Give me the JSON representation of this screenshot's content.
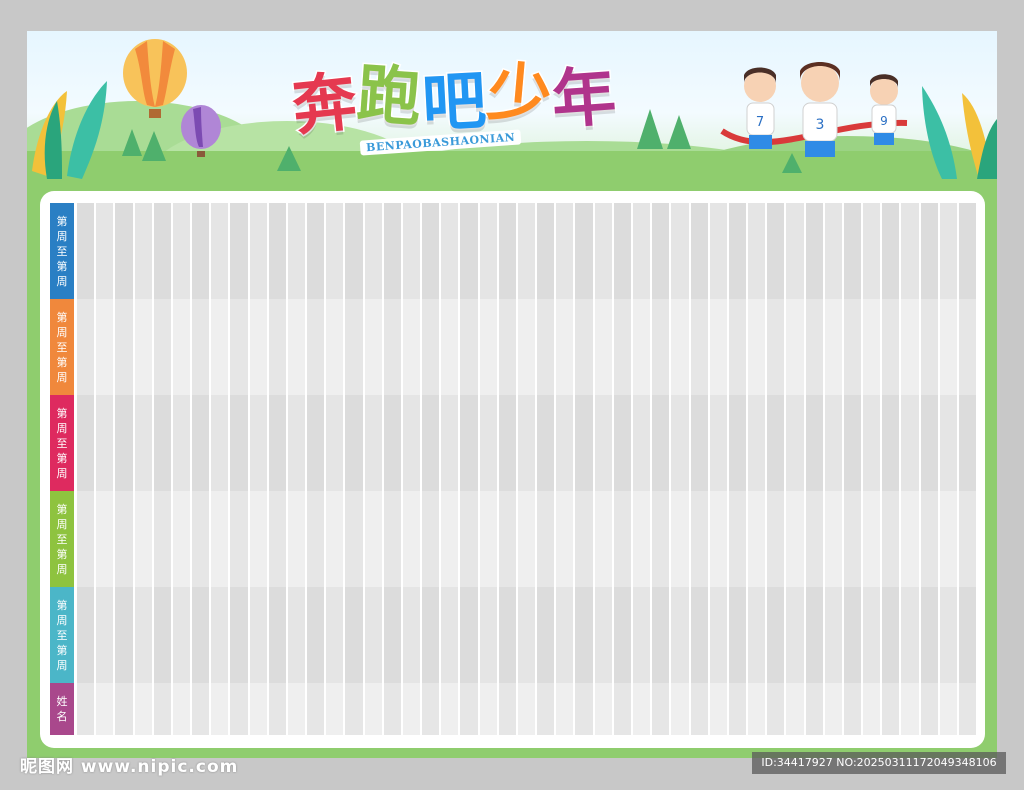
{
  "header": {
    "title_chars": [
      "奔",
      "跑",
      "吧",
      "少",
      "年"
    ],
    "title_colors": [
      "#e53950",
      "#8bc34a",
      "#2196f3",
      "#ff8a1f",
      "#b0348c"
    ],
    "subtitle": "BENPAOBASHAONIAN"
  },
  "grid": {
    "rows": [
      {
        "label": "第周至第周",
        "color": "#2a7fc4"
      },
      {
        "label": "第周至第周",
        "color": "#f0883c"
      },
      {
        "label": "第周至第周",
        "color": "#de2a5f"
      },
      {
        "label": "第周至第周",
        "color": "#8ec33f"
      },
      {
        "label": "第周至第周",
        "color": "#4bb6c8"
      },
      {
        "label": "姓名",
        "color": "#a9488c"
      }
    ],
    "column_count": 47
  },
  "illustration": {
    "balloons": [
      "hot-air-balloon-orange",
      "hot-air-balloon-purple"
    ],
    "runner_numbers": [
      "7",
      "3",
      "9"
    ]
  },
  "watermark": {
    "left": "昵图网 www.nipic.com",
    "right": "ID:34417927 NO:20250311172049348106"
  }
}
